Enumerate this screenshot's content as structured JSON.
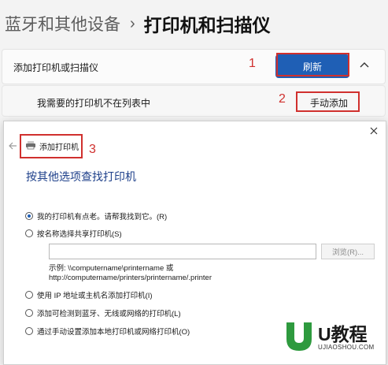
{
  "breadcrumb": {
    "parent": "蓝牙和其他设备",
    "separator": "›",
    "current": "打印机和扫描仪"
  },
  "add_printer_card": {
    "label": "添加打印机或扫描仪",
    "refresh_button": "刷新",
    "expand_icon": "chevron-up-icon"
  },
  "not_listed_card": {
    "label": "我需要的打印机不在列表中",
    "manual_add_button": "手动添加"
  },
  "annotations": {
    "step1": "1",
    "step2": "2",
    "step3": "3",
    "highlight_color": "#d0302e"
  },
  "dialog": {
    "close_icon": "close-icon",
    "back_icon": "back-arrow-icon",
    "wizard_title": "添加打印机",
    "wizard_icon": "printer-icon",
    "heading": "按其他选项查找打印机",
    "options": [
      {
        "label": "我的打印机有点老。请帮我找到它。(R)",
        "checked": true
      },
      {
        "label": "按名称选择共享打印机(S)",
        "checked": false
      },
      {
        "label": "使用 IP 地址或主机名添加打印机(I)",
        "checked": false
      },
      {
        "label": "添加可检测到蓝牙、无线或网络的打印机(L)",
        "checked": false
      },
      {
        "label": "通过手动设置添加本地打印机或网络打印机(O)",
        "checked": false
      }
    ],
    "share_name_input": {
      "value": "",
      "placeholder": ""
    },
    "browse_button": "浏览(R)...",
    "example_line1": "示例: \\\\computername\\printername 或",
    "example_line2": "http://computername/printers/printername/.printer"
  },
  "watermark": {
    "title": "U教程",
    "url": "UJIAOSHOU.COM",
    "accent": "#2e9a3e"
  },
  "colors": {
    "accent_blue": "#1f5fb5",
    "heading_blue": "#1d3f8a",
    "page_bg": "#f3f3f3"
  }
}
